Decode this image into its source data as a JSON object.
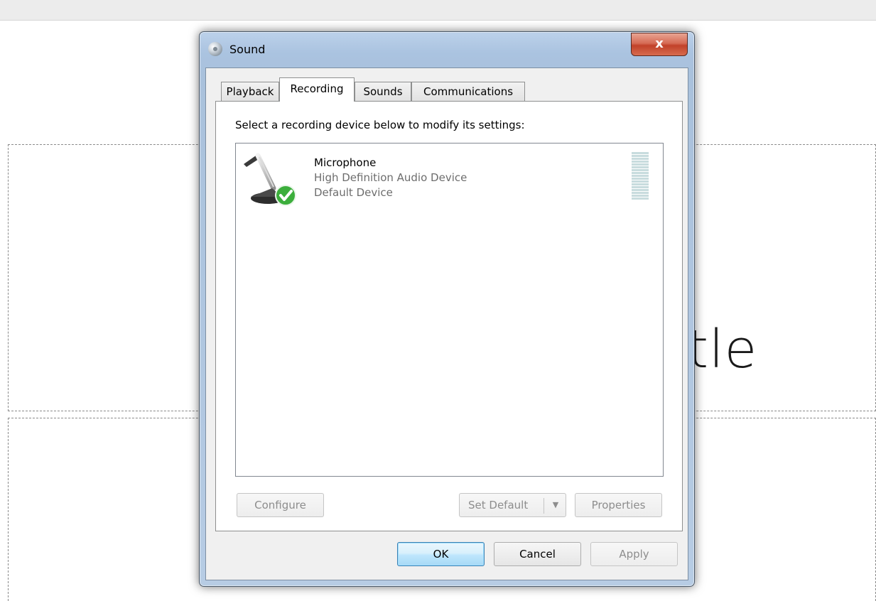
{
  "background": {
    "slide_title_fragment": "tle"
  },
  "window": {
    "title": "Sound",
    "close_label": "x"
  },
  "tabs": [
    {
      "label": "Playback"
    },
    {
      "label": "Recording"
    },
    {
      "label": "Sounds"
    },
    {
      "label": "Communications"
    }
  ],
  "recording": {
    "instruction": "Select a recording device below to modify its settings:",
    "devices": [
      {
        "name": "Microphone",
        "description": "High Definition Audio Device",
        "status": "Default Device",
        "icon": "microphone-icon",
        "default_badge_color": "#3cae3c"
      }
    ],
    "buttons": {
      "configure": "Configure",
      "set_default": "Set Default",
      "properties": "Properties"
    }
  },
  "footer": {
    "ok": "OK",
    "cancel": "Cancel",
    "apply": "Apply"
  },
  "colors": {
    "ok_button_border": "#3c7fb1",
    "close_button": "#c1422a",
    "level_meter": "#c8dcde"
  }
}
